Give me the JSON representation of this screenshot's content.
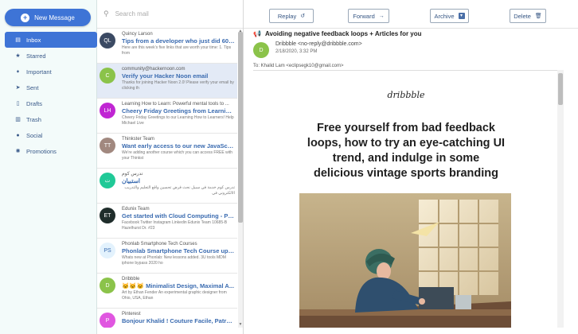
{
  "compose": {
    "label": "New Message"
  },
  "sidebar": {
    "items": [
      {
        "label": "Inbox",
        "icon": "inbox-icon",
        "active": true
      },
      {
        "label": "Starred",
        "icon": "star-icon"
      },
      {
        "label": "Important",
        "icon": "important-icon"
      },
      {
        "label": "Sent",
        "icon": "send-icon"
      },
      {
        "label": "Drafts",
        "icon": "drafts-icon"
      },
      {
        "label": "Trash",
        "icon": "trash-icon"
      },
      {
        "label": "Social",
        "icon": "social-icon"
      },
      {
        "label": "Promotions",
        "icon": "promotions-icon"
      }
    ]
  },
  "search": {
    "placeholder": "Search mail"
  },
  "messages": [
    {
      "initials": "QL",
      "color": "#3b4a63",
      "sender": "Quincy Larson",
      "subject": "Tips from a developer who just did 60 c...",
      "preview": "Here are this week's five links that are worth your time: 1. Tips from"
    },
    {
      "initials": "C",
      "color": "#8bc34a",
      "sender": "community@hackernoon.com",
      "subject": "Verify your Hacker Noon email",
      "preview": "Thanks for joining Hacker Noon 2.0! Please verify your email by clicking th"
    },
    {
      "initials": "LH",
      "color": "#c026d3",
      "sender": "Learning How to Learn: Powerful mental tools to ...",
      "subject": "Cheery Friday Greetings from Learning ...",
      "preview": "Cheery Friday Greetings to our Learning How to Learners! Help Michael Live"
    },
    {
      "initials": "TT",
      "color": "#a1887f",
      "sender": "Thinkster Team",
      "subject": "Want early access to our new JavaScript ...",
      "preview": "We're adding another course which you can access FREE with your Thinkst"
    },
    {
      "initials": "ت",
      "color": "#20c997",
      "sender": "تدرس كوم",
      "subject": "استبيان",
      "preview": "تدرس كوم خدمة في سبيل نحث فرض تحسين واقع التعليم والتدريب الالكتروني في",
      "rtl": true
    },
    {
      "initials": "ET",
      "color": "#1f2d2b",
      "sender": "Edunix Team",
      "subject": "Get started with Cloud Computing - Ple...",
      "preview": "Facebook Twitter Instagram Linkedin Edunix Team 10685-B Hazelhurst Dr. #23"
    },
    {
      "initials": "PS",
      "color": "#e3f2fd",
      "initials_color": "#3a6bb0",
      "sender": "Phonlab Smartphone Tech Courses",
      "subject": "Phonlab Smartphone Tech Course updat...",
      "preview": "Whats new at Phonlab: New lessons added. 3U tools MDM iphone bypass 2020 ho"
    },
    {
      "initials": "D",
      "color": "#8bc34a",
      "sender": "Dribbble",
      "subject": "🐱🐱🐱 Minimalist Design, Maximal A...",
      "preview": "Art by Ethan Fender An experimental graphic designer from Ohio, USA, Ethan"
    },
    {
      "initials": "P",
      "color": "#e056e0",
      "sender": "Pinterest",
      "subject": "Bonjour Khalid ! Couture Facile, Patron ...",
      "preview": ""
    }
  ],
  "toolbar": {
    "reply": "Replay",
    "forward": "Forward",
    "archive": "Archive",
    "delete": "Delete"
  },
  "email": {
    "subject": "Avoiding negative feedback loops + Articles for you",
    "from_initial": "D",
    "from_color": "#8bc34a",
    "from_line": "Dribbble <no-reply@dribbble.com>",
    "date": "2/18/2020, 3:32 PM",
    "to": "To: Khalid Lam <eclipsegk10@gmail.com>",
    "brand": "dribbble",
    "headline": "Free yourself from bad feedback loops, how to try an eye-catching UI trend, and indulge in some delicious vintage sports branding"
  }
}
